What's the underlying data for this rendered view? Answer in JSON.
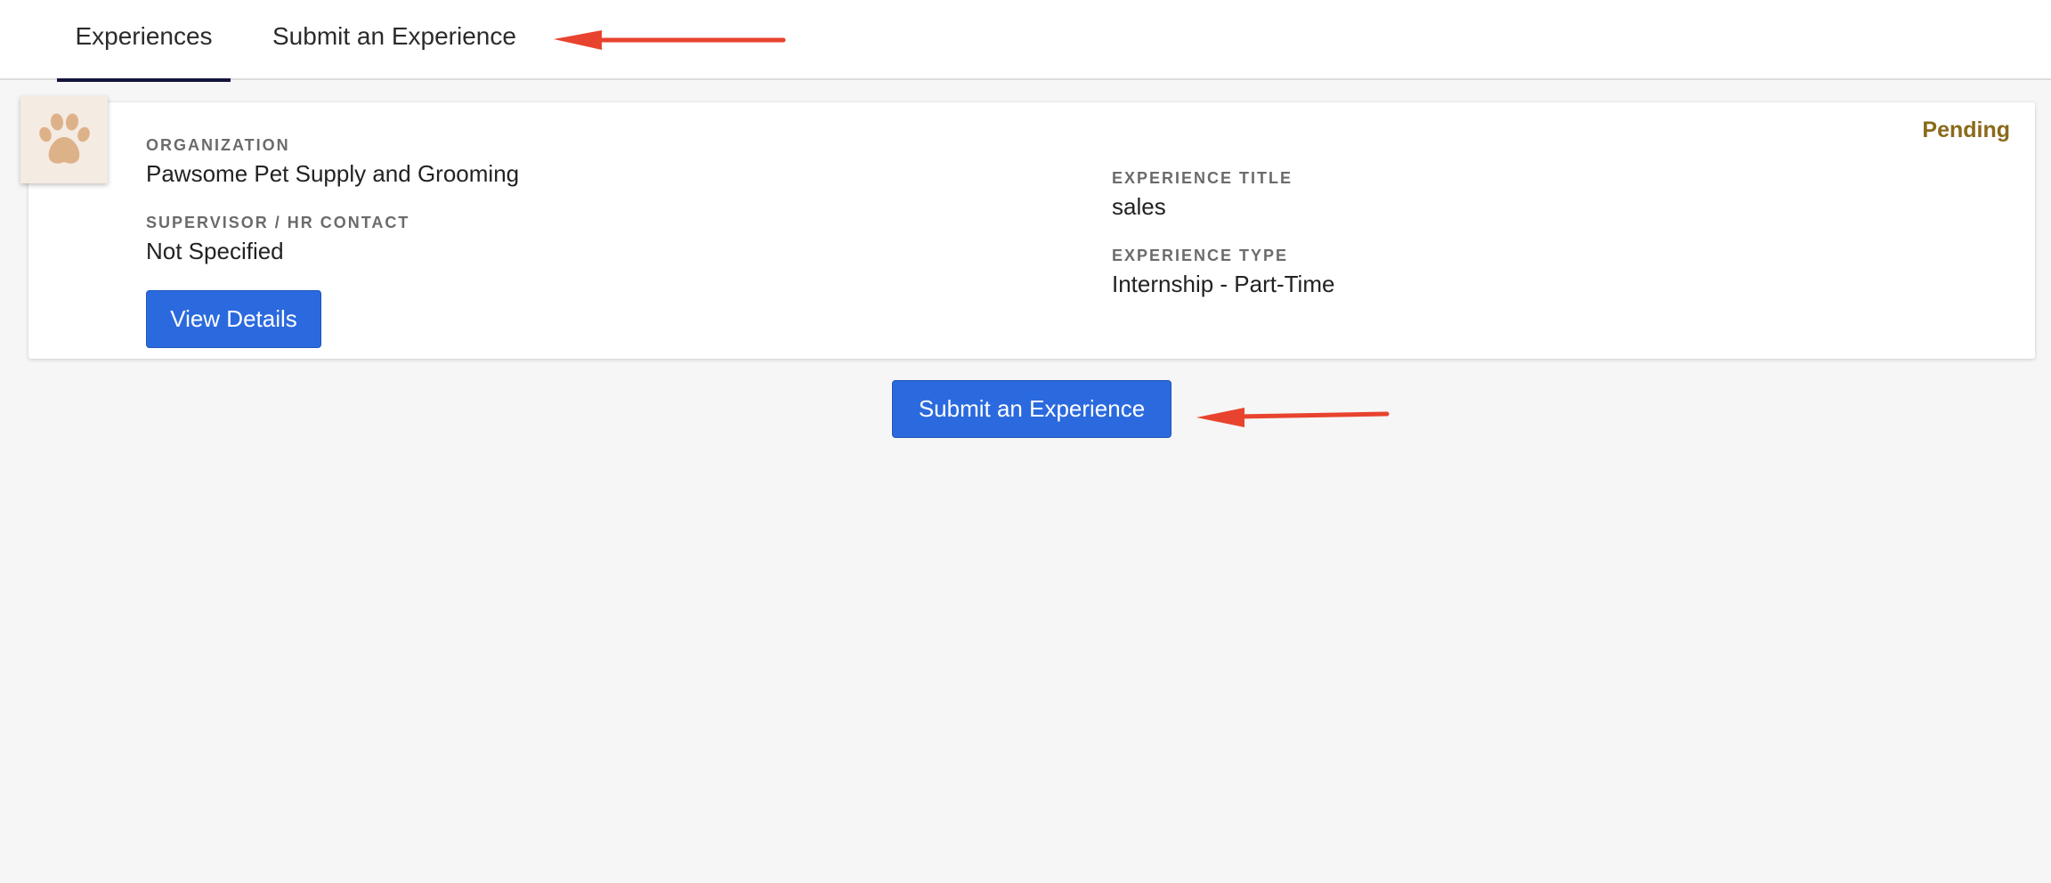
{
  "tabs": [
    {
      "label": "Experiences",
      "active": true
    },
    {
      "label": "Submit an Experience",
      "active": false
    }
  ],
  "experience": {
    "status": "Pending",
    "organization_label": "ORGANIZATION",
    "organization": "Pawsome Pet Supply and Grooming",
    "supervisor_label": "SUPERVISOR / HR CONTACT",
    "supervisor": "Not Specified",
    "title_label": "EXPERIENCE TITLE",
    "title": "sales",
    "type_label": "EXPERIENCE TYPE",
    "type": "Internship - Part-Time",
    "view_details_label": "View Details",
    "logo_icon": "paw-icon"
  },
  "submit_button_label": "Submit an Experience",
  "colors": {
    "primary_button": "#2b6ade",
    "status_pending": "#8a6a1a",
    "active_tab_underline": "#14153a",
    "annotation_arrow": "#e8432e",
    "logo_paw": "#deb289"
  }
}
